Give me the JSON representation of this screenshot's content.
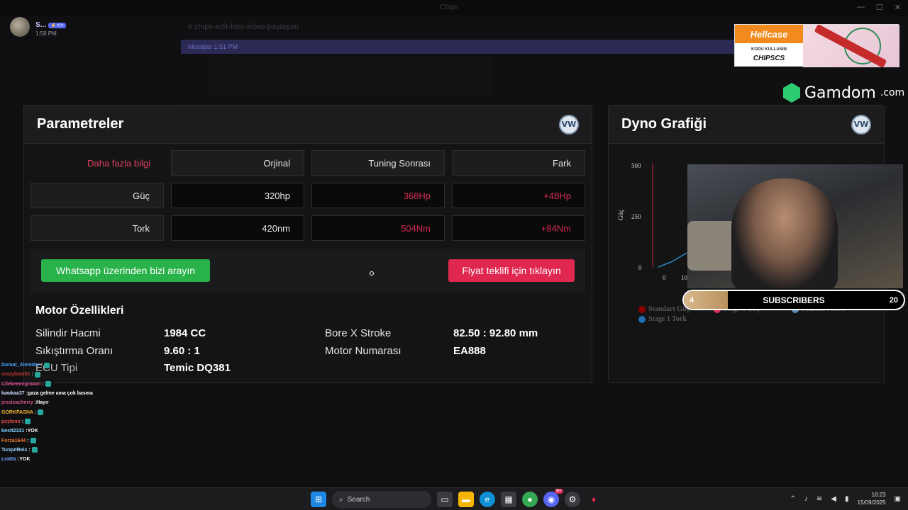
{
  "app": {
    "window_title": "Chips"
  },
  "profile": {
    "username": "S...",
    "tag": "⚡</>",
    "time": "1:58 PM"
  },
  "background": {
    "channel": "chips-edit-foto-video-paylaşım",
    "banner": "Mesajlar 1:51 PM"
  },
  "params_panel": {
    "title": "Parametreler",
    "more_info_link": "Daha fazla bilgi",
    "col_original": "Orjinal",
    "col_tuning": "Tuning Sonrası",
    "col_diff": "Fark",
    "rows": [
      {
        "label": "Güç",
        "original": "320hp",
        "tuned": "368Hp",
        "diff": "+48Hp"
      },
      {
        "label": "Tork",
        "original": "420nm",
        "tuned": "504Nm",
        "diff": "+84Nm"
      }
    ],
    "whatsapp_button": "Whatsapp üzerinden bizi arayın",
    "quote_button": "Fiyat teklifi için tıklayın",
    "motor_title": "Motor Özellikleri",
    "specs": {
      "displacement_label": "Silindir Hacmi",
      "displacement_value": "1984 CC",
      "bore_label": "Bore X Stroke",
      "bore_value": "82.50 : 92.80 mm",
      "compression_label": "Sıkıştırma Oranı",
      "compression_value": "9.60 : 1",
      "engine_no_label": "Motor Numarası",
      "engine_no_value": "EA888",
      "ecu_label": "ECU Tipi",
      "ecu_value": "Temic DQ381"
    }
  },
  "dyno_panel": {
    "title": "Dyno Grafiği",
    "ylabel": "Güç",
    "y_ticks": [
      "500",
      "250",
      "0"
    ],
    "x_ticks": [
      "0",
      "10"
    ],
    "legend": [
      {
        "name": "Standart Güç",
        "color": "#8b0000"
      },
      {
        "name": "Stage 1 Güç",
        "color": "#e0274f"
      },
      {
        "name": "Standart Tork",
        "color": "#5b8db8"
      },
      {
        "name": "Stage 1 Tork",
        "color": "#1f6fb0"
      }
    ]
  },
  "subscribers": {
    "label": "SUBSCRIBERS",
    "current": "4",
    "goal": "20",
    "progress": 0.2
  },
  "sponsor": {
    "hellcase_logo": "Hellcase",
    "hellcase_line1": "KODU KULLANIN",
    "hellcase_line2": "CHIPSCS",
    "gamdom_name": "Gamdom",
    "gamdom_tld": ".com"
  },
  "chat": [
    {
      "user": "Domat_Alemdar",
      "color": "#4da3ff",
      "msg": ""
    },
    {
      "user": "crazybatu01",
      "color": "#c0392b",
      "msg": ""
    },
    {
      "user": "Cilekeeengmaan",
      "color": "#e05599",
      "msg": ""
    },
    {
      "user": "kawkaa37",
      "color": "#cfd8ff",
      "msg": "gaza gelme ama çok basma"
    },
    {
      "user": "jessicacherry",
      "color": "#d94f8c",
      "msg": "Hayır"
    },
    {
      "user": "GORKPASHA",
      "color": "#f2b233",
      "msg": ""
    },
    {
      "user": "psybnrz",
      "color": "#e34a4a",
      "msg": ""
    },
    {
      "user": "bestt2331",
      "color": "#7fd6ff",
      "msg": "YOK"
    },
    {
      "user": "Forza1644",
      "color": "#f07a2e",
      "msg": ""
    },
    {
      "user": "TurqutReis",
      "color": "#9bd0ff",
      "msg": ""
    },
    {
      "user": "Lrat0s",
      "color": "#6fa8ff",
      "msg": "YOK"
    }
  ],
  "taskbar": {
    "search_placeholder": "Search",
    "time": "16:23",
    "date": "15/09/2025",
    "discord_badge": "9+"
  }
}
